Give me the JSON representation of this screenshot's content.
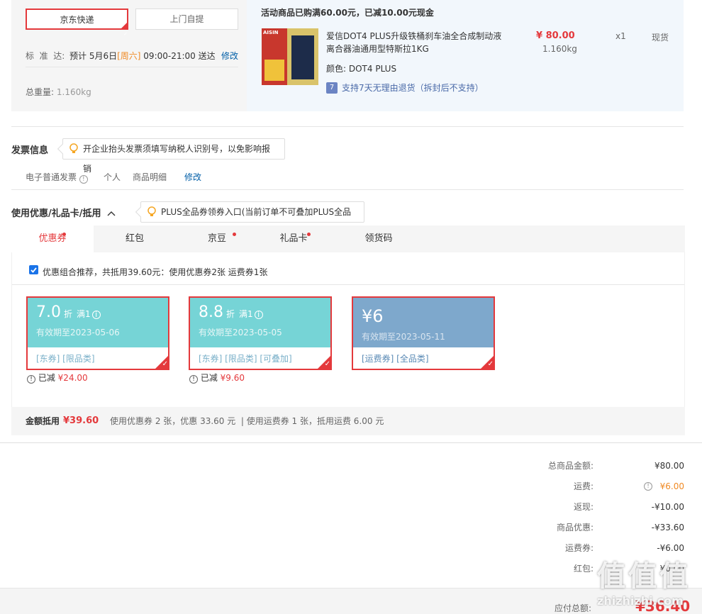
{
  "shipping": {
    "option_selected": "京东快递",
    "option_other": "上门自提",
    "standard_label": "标  准  达:",
    "estimate_prefix": "预计 5月6日",
    "estimate_day": "[周六]",
    "estimate_suffix": "09:00-21:00 送达",
    "modify": "修改",
    "weight_label": "总重量:",
    "weight_value": "1.160kg"
  },
  "promo": {
    "banner": "活动商品已购满60.00元，已减10.00元现金"
  },
  "product": {
    "title_line1": "爱信DOT4 PLUS升级铁桶刹车油全合成制动液",
    "title_line2": "离合器油通用型特斯拉1KG",
    "price": "¥ 80.00",
    "weight": "1.160kg",
    "qty": "x1",
    "stock": "现货",
    "color_label": "颜色:",
    "color_value": "DOT4 PLUS",
    "return_icon": "7",
    "return_text": "支持7天无理由退货（拆封后不支持）",
    "image_brand": "AISIN"
  },
  "invoice": {
    "title": "发票信息",
    "tip": "开企业抬头发票须填写纳税人识别号，以免影响报销",
    "type": "电子普通发票",
    "holder": "个人",
    "content": "商品明细",
    "modify": "修改"
  },
  "discount": {
    "title": "使用优惠/礼品卡/抵用",
    "tip": "PLUS全品券领券入口(当前订单不可叠加PLUS全品券)",
    "tabs": [
      {
        "label": "优惠券",
        "dot": true
      },
      {
        "label": "红包",
        "dot": false
      },
      {
        "label": "京豆",
        "dot": true
      },
      {
        "label": "礼品卡",
        "dot": true
      },
      {
        "label": "领货码",
        "dot": false
      }
    ],
    "combo_text": "优惠组合推荐，共抵用39.60元：使用优惠券2张 运费券1张",
    "coupons": [
      {
        "amount": "7.0",
        "unit": "折",
        "cond": "满1",
        "expire": "有效期至2023-05-06",
        "tags": "[东券]  [限品类]",
        "saved_label": "已减",
        "saved": "¥24.00"
      },
      {
        "amount": "8.8",
        "unit": "折",
        "cond": "满1",
        "expire": "有效期至2023-05-05",
        "tags": "[东券]  [限品类]  [可叠加]",
        "saved_label": "已减",
        "saved": "¥9.60"
      },
      {
        "amount": "¥6",
        "unit": "",
        "cond": "",
        "expire": "有效期至2023-05-11",
        "tags": "[运费券]  [全品类]",
        "saved_label": "",
        "saved": ""
      }
    ],
    "summary_label": "金额抵用",
    "summary_amount": "¥39.60",
    "summary_detail": "使用优惠券 2 张，优惠 33.60 元  | 使用运费券 1 张，抵用运费 6.00 元"
  },
  "totals": {
    "rows": [
      {
        "label": "总商品金额:",
        "value": "¥80.00"
      },
      {
        "label": "运费:",
        "value": "¥6.00"
      },
      {
        "label": "返现:",
        "value": "-¥10.00"
      },
      {
        "label": "商品优惠:",
        "value": "-¥33.60"
      },
      {
        "label": "运费券:",
        "value": "-¥6.00"
      },
      {
        "label": "红包:",
        "value": "¥0.00"
      }
    ],
    "payable_label": "应付总额:",
    "payable_value": "¥36.40"
  },
  "watermark": {
    "text": "值值值",
    "url": "zhizhizhi.com"
  },
  "colors": {
    "accent": "#e4393c",
    "coupon_teal": "#76d4d6",
    "coupon_blue": "#7ea8cc",
    "link": "#005ea7"
  }
}
